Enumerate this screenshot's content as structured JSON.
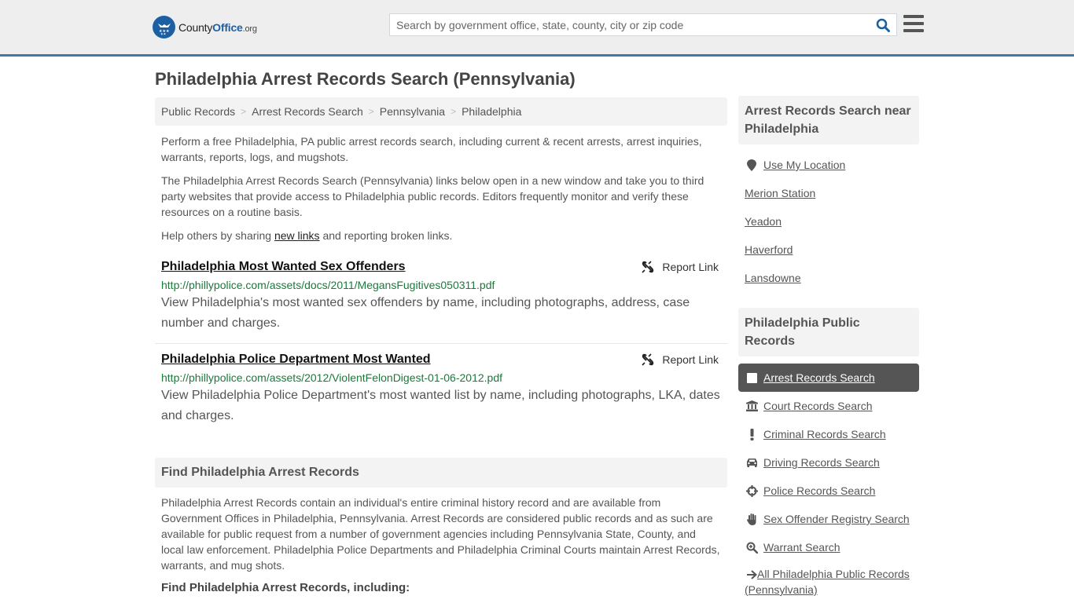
{
  "header": {
    "logo": {
      "name": "County",
      "name_accent": "Office",
      "tld": ".org"
    },
    "search": {
      "placeholder": "Search by government office, state, county, city or zip code",
      "value": ""
    }
  },
  "page": {
    "title": "Philadelphia Arrest Records Search (Pennsylvania)"
  },
  "breadcrumb": [
    "Public Records",
    "Arrest Records Search",
    "Pennsylvania",
    "Philadelphia"
  ],
  "intro": {
    "p1": "Perform a free Philadelphia, PA public arrest records search, including current & recent arrests, arrest inquiries, warrants, reports, logs, and mugshots.",
    "p2": "The Philadelphia Arrest Records Search (Pennsylvania) links below open in a new window and take you to third party websites that provide access to Philadelphia public records. Editors frequently monitor and verify these resources on a routine basis.",
    "p3_before": "Help others by sharing ",
    "p3_link": "new links",
    "p3_after": " and reporting broken links."
  },
  "links": [
    {
      "title": "Philadelphia Most Wanted Sex Offenders",
      "url": "http://phillypolice.com/assets/docs/2011/MegansFugitives050311.pdf",
      "description": "View Philadelphia's most wanted sex offenders by name, including photographs, address, case number and charges.",
      "report_label": "Report Link"
    },
    {
      "title": "Philadelphia Police Department Most Wanted",
      "url": "http://phillypolice.com/assets/2012/ViolentFelonDigest-01-06-2012.pdf",
      "description": "View Philadelphia Police Department's most wanted list by name, including photographs, LKA, dates and charges.",
      "report_label": "Report Link"
    }
  ],
  "find_section": {
    "heading": "Find Philadelphia Arrest Records",
    "body": "Philadelphia Arrest Records contain an individual's entire criminal history record and are available from Government Offices in Philadelphia, Pennsylvania. Arrest Records are considered public records and as such are available for public request from a number of government agencies including Pennsylvania State, County, and local law enforcement. Philadelphia Police Departments and Philadelphia Criminal Courts maintain Arrest Records, warrants, and mug shots.",
    "subheading": "Find Philadelphia Arrest Records, including:"
  },
  "sidebar": {
    "near": {
      "heading": "Arrest Records Search near Philadelphia",
      "use_location": "Use My Location",
      "places": [
        "Merion Station",
        "Yeadon",
        "Haverford",
        "Lansdowne"
      ]
    },
    "public_records": {
      "heading": "Philadelphia Public Records",
      "items": [
        {
          "label": "Arrest Records Search",
          "icon": "square-icon",
          "active": true
        },
        {
          "label": "Court Records Search",
          "icon": "courthouse-icon"
        },
        {
          "label": "Criminal Records Search",
          "icon": "exclamation-icon"
        },
        {
          "label": "Driving Records Search",
          "icon": "car-icon"
        },
        {
          "label": "Police Records Search",
          "icon": "crosshairs-icon"
        },
        {
          "label": "Sex Offender Registry Search",
          "icon": "hand-icon"
        },
        {
          "label": "Warrant Search",
          "icon": "search-plus-icon"
        },
        {
          "label": "All Philadelphia Public Records (Pennsylvania)",
          "icon": "arrow-right-icon"
        }
      ]
    }
  },
  "colors": {
    "brand_blue": "#1d5fa3",
    "header_border": "#3a7bb0",
    "url_green": "#1a7a3a",
    "active_item_bg": "#555555"
  }
}
